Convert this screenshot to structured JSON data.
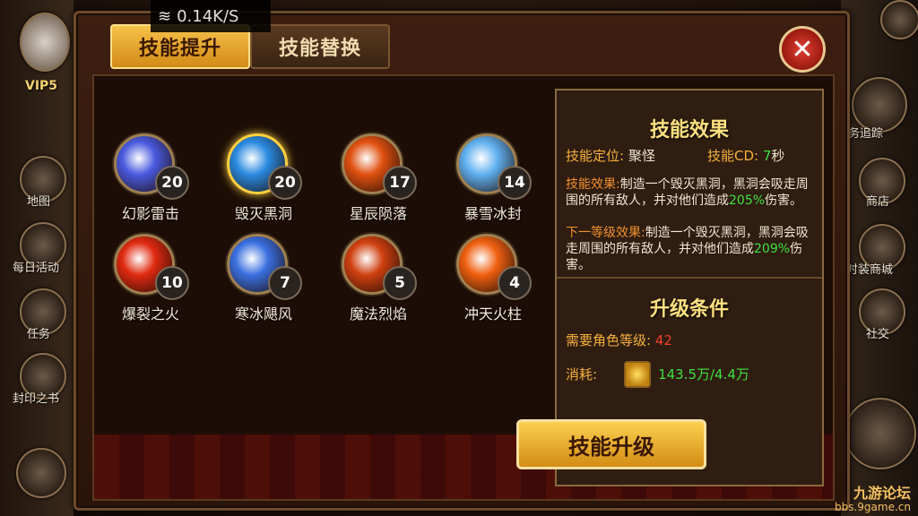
{
  "status": {
    "network_speed": "0.14K/S"
  },
  "tabs": {
    "skill_upgrade": "技能提升",
    "skill_replace": "技能替换"
  },
  "left_hud": {
    "vip": "VIP5",
    "items": [
      {
        "label": "地图"
      },
      {
        "label": "每日活动"
      },
      {
        "label": "任务"
      },
      {
        "label": "封印之书"
      }
    ]
  },
  "right_hud": {
    "items": [
      {
        "label": "务追踪"
      },
      {
        "label": "商店"
      },
      {
        "label": "时装商城"
      },
      {
        "label": "社交"
      }
    ]
  },
  "skills": [
    {
      "name": "幻影雷击",
      "level": "20",
      "color": "#4a5adf"
    },
    {
      "name": "毁灭黑洞",
      "level": "20",
      "color": "#2a8ae0",
      "selected": true
    },
    {
      "name": "星辰陨落",
      "level": "17",
      "color": "#e05010"
    },
    {
      "name": "暴雪冰封",
      "level": "14",
      "color": "#60b0f0"
    },
    {
      "name": "爆裂之火",
      "level": "10",
      "color": "#e02a10"
    },
    {
      "name": "寒冰飓风",
      "level": "7",
      "color": "#3a70e0"
    },
    {
      "name": "魔法烈焰",
      "level": "5",
      "color": "#d04010"
    },
    {
      "name": "冲天火柱",
      "level": "4",
      "color": "#f06010"
    }
  ],
  "effect": {
    "title": "技能效果",
    "position_label": "技能定位:",
    "position_value": "聚怪",
    "cd_label": "技能CD:",
    "cd_value": "7",
    "cd_unit": "秒",
    "effect_label": "技能效果:",
    "effect_text_a": "制造一个毁灭黑洞，黑洞会吸走周围的所有敌人，并对他们造成",
    "effect_pct": "205%",
    "effect_text_b": "伤害。",
    "next_label": "下一等级效果:",
    "next_text_a": "制造一个毁灭黑洞，黑洞会吸走周围的所有敌人，并对他们造成",
    "next_pct": "209%",
    "next_text_b": "伤害。"
  },
  "upgrade": {
    "title": "升级条件",
    "level_req_label": "需要角色等级:",
    "level_req_value": "42",
    "cost_label": "消耗:",
    "cost_value": "143.5万/4.4万",
    "button": "技能升级"
  },
  "watermark": {
    "line1": "九游论坛",
    "line2": "bbs.9game.cn"
  },
  "colors": {
    "accent": "#f6c24a",
    "panel": "#2a140a",
    "highlight": "#40e040",
    "warn": "#f04030"
  }
}
